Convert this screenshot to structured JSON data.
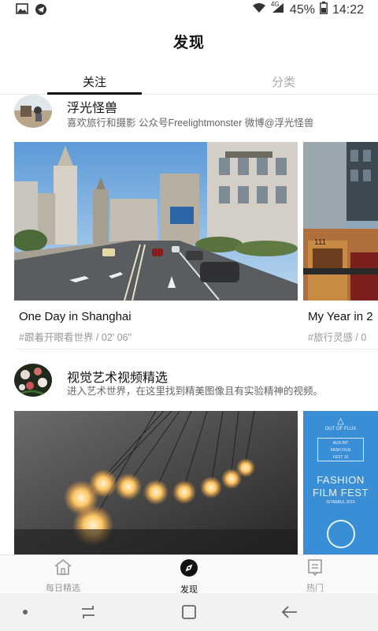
{
  "status_bar": {
    "battery": "45%",
    "time": "14:22",
    "signal_label": "4G"
  },
  "header": {
    "title": "发现"
  },
  "tabs": [
    {
      "label": "关注",
      "active": true
    },
    {
      "label": "分类",
      "active": false
    }
  ],
  "channels": [
    {
      "name": "浮光怪兽",
      "description": "喜欢旅行和摄影 公众号Freelightmonster 微博@浮光怪兽",
      "videos": [
        {
          "title": "One Day in Shanghai",
          "tag": "#跟着开眼看世界 / 02' 06\""
        },
        {
          "title": "My Year in 2",
          "tag": "#旅行灵感 / 0"
        }
      ]
    },
    {
      "name": "视觉艺术视频精选",
      "description": "进入艺术世界，在这里找到精美图像且有实验精神的视频。",
      "videos": [
        {
          "title": "",
          "tag": ""
        },
        {
          "title": "",
          "tag": ""
        }
      ],
      "poster_text": {
        "top": "OUT OF FLUX",
        "lines": [
          "AUS INT",
          "FASH FILM",
          "FEST 15"
        ],
        "big": [
          "FASHION",
          "FILM FEST"
        ],
        "city": "ISTANBUL 2015"
      }
    }
  ],
  "bottom_nav": [
    {
      "label": "每日精选",
      "icon": "home-icon",
      "active": false
    },
    {
      "label": "发现",
      "icon": "compass-icon",
      "active": true
    },
    {
      "label": "热门",
      "icon": "hot-list-icon",
      "active": false
    }
  ],
  "colors": {
    "accent": "#111111",
    "inactive": "#999999",
    "poster_blue": "#3a8ed6"
  }
}
